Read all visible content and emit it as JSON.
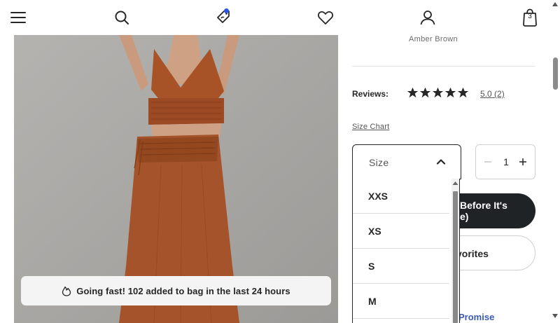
{
  "nav": {
    "menu_icon": "hamburger-icon",
    "search_icon": "search-icon",
    "rewards_icon": "tag-icon",
    "favorites_icon": "heart-icon",
    "account_icon": "user-icon",
    "bag_icon": "shopping-bag-icon",
    "bag_count": "3",
    "notification_color": "#2b55e6"
  },
  "product": {
    "color_name": "Amber Brown",
    "image_icon": "product-photo",
    "urgency": {
      "icon": "flame-icon",
      "text": "Going fast! 102 added to bag in the last 24 hours"
    }
  },
  "reviews": {
    "label": "Reviews:",
    "stars": 5,
    "score": "5.0",
    "count": "(2)"
  },
  "size_chart_label": "Size Chart",
  "size_select": {
    "label": "Size",
    "icon": "chevron-up-icon"
  },
  "quantity": {
    "value": "1",
    "minus_icon": "minus-icon",
    "plus_icon": "plus-icon"
  },
  "buttons": {
    "dark_line1": "Before It's",
    "dark_line2": "e)",
    "favorites": "vorites"
  },
  "promise_text": "Promise",
  "size_options": [
    "XXS",
    "XS",
    "S",
    "M"
  ]
}
